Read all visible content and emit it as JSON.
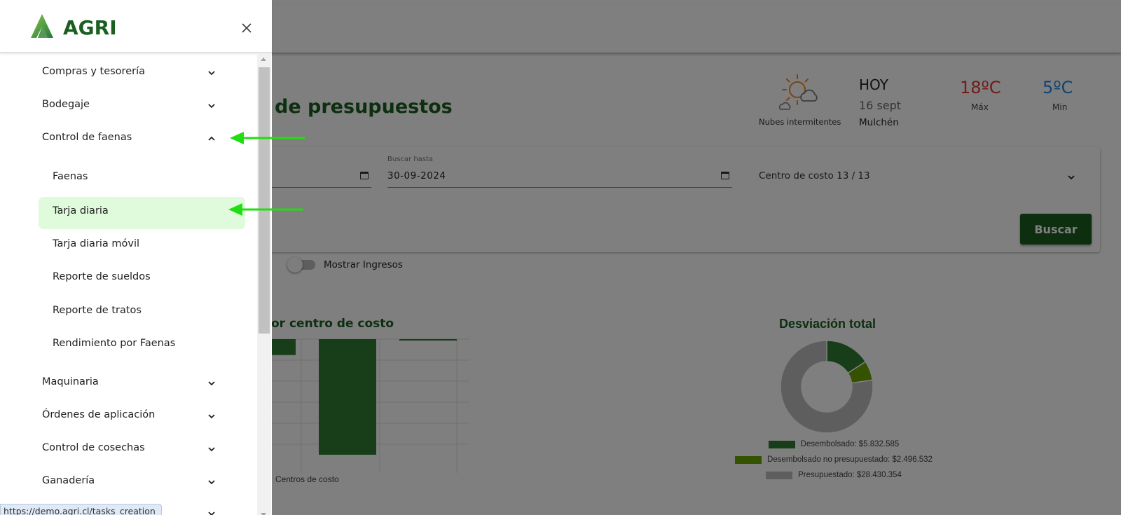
{
  "page": {
    "title": "de presupuestos"
  },
  "weather": {
    "description": "Nubes intermitentes",
    "today": "HOY",
    "date": "16 sept",
    "city": "Mulchén",
    "max_temp": "18ºC",
    "max_label": "Máx",
    "min_temp": "5ºC",
    "min_label": "Min",
    "icon": "sun-cloud-icon"
  },
  "filters": {
    "date_to_label": "Buscar hasta",
    "date_to_value": "30-09-2024",
    "cost_center": "Centro de costo 13 / 13",
    "search_button": "Buscar",
    "toggle_label": "Mostrar Ingresos",
    "toggle_on": false
  },
  "chart_data": [
    {
      "type": "bar",
      "title": "or centro de costo",
      "xlabel": "Centros de costo",
      "bars_visible": [
        {
          "value": -0.4,
          "color": "#2e7d32"
        },
        {
          "value": -2.9,
          "color": "#2e7d32"
        },
        {
          "value": -0.03,
          "color": "#2e7d32"
        }
      ],
      "grid": true
    },
    {
      "type": "pie",
      "title": "Desviación total",
      "donut": true,
      "slices": [
        {
          "label": "Desembolsado: $5.832.585",
          "value": 5832585,
          "color": "#2e7d32"
        },
        {
          "label": "Desembolsado no presupuestado: $2.496.532",
          "value": 2496532,
          "color": "#6aa500"
        },
        {
          "label": "Presupuestado: $28.430.354",
          "value": 28430354,
          "color": "#bdbdbd"
        }
      ]
    }
  ],
  "drawer": {
    "logo_text": "AGRI",
    "close_icon": "close-icon",
    "menu": [
      {
        "label": "Compras y tesorería",
        "expanded": false
      },
      {
        "label": "Bodegaje",
        "expanded": false
      },
      {
        "label": "Control de faenas",
        "expanded": true
      },
      {
        "label": "Maquinaria",
        "expanded": false
      },
      {
        "label": "Órdenes de aplicación",
        "expanded": false
      },
      {
        "label": "Control de cosechas",
        "expanded": false
      },
      {
        "label": "Ganadería",
        "expanded": false
      }
    ],
    "submenu": [
      {
        "label": "Faenas",
        "active": false
      },
      {
        "label": "Tarja diaria",
        "active": true
      },
      {
        "label": "Tarja diaria móvil",
        "active": false
      },
      {
        "label": "Reporte de sueldos",
        "active": false
      },
      {
        "label": "Reporte de tratos",
        "active": false
      },
      {
        "label": "Rendimiento por Faenas",
        "active": false
      }
    ]
  },
  "status_url": "https://demo.agri.cl/tasks_creation",
  "colors": {
    "brand_green": "#1b5e20",
    "active_bg": "#dffbdc",
    "annotation_arrow": "#22dd11"
  }
}
